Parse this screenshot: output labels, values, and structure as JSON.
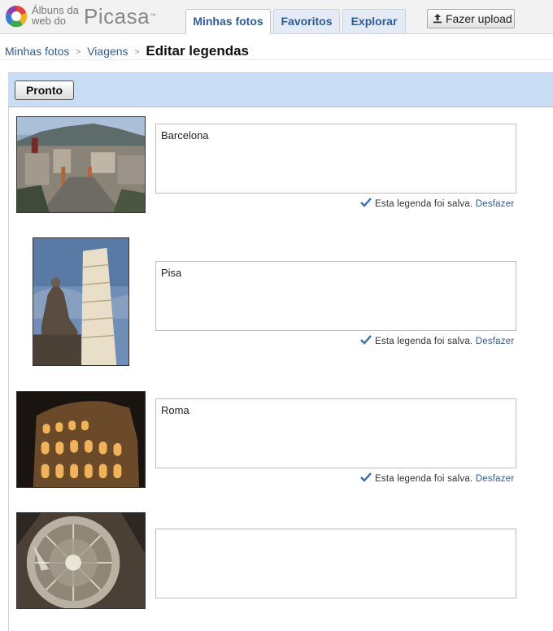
{
  "header": {
    "logo_line1": "Álbuns da",
    "logo_line2": "web do",
    "logo_brand": "Picasa",
    "tabs": [
      {
        "label": "Minhas fotos",
        "active": true
      },
      {
        "label": "Favoritos",
        "active": false
      },
      {
        "label": "Explorar",
        "active": false
      }
    ],
    "upload_label": "Fazer upload"
  },
  "breadcrumb": {
    "items": [
      "Minhas fotos",
      "Viagens"
    ],
    "separator": ">",
    "current": "Editar legendas"
  },
  "toolbar": {
    "done_label": "Pronto"
  },
  "photos": [
    {
      "caption": "Barcelona",
      "saved_text": "Esta legenda foi salva.",
      "undo_label": "Desfazer"
    },
    {
      "caption": "Pisa",
      "saved_text": "Esta legenda foi salva.",
      "undo_label": "Desfazer"
    },
    {
      "caption": "Roma",
      "saved_text": "Esta legenda foi salva.",
      "undo_label": "Desfazer"
    },
    {
      "caption": ""
    }
  ],
  "colors": {
    "link": "#2d5c9e",
    "bar": "#c9ddf7",
    "check": "#3a6cb5"
  },
  "icons": [
    "picasa-logo-icon",
    "upload-icon",
    "checkmark-icon"
  ]
}
